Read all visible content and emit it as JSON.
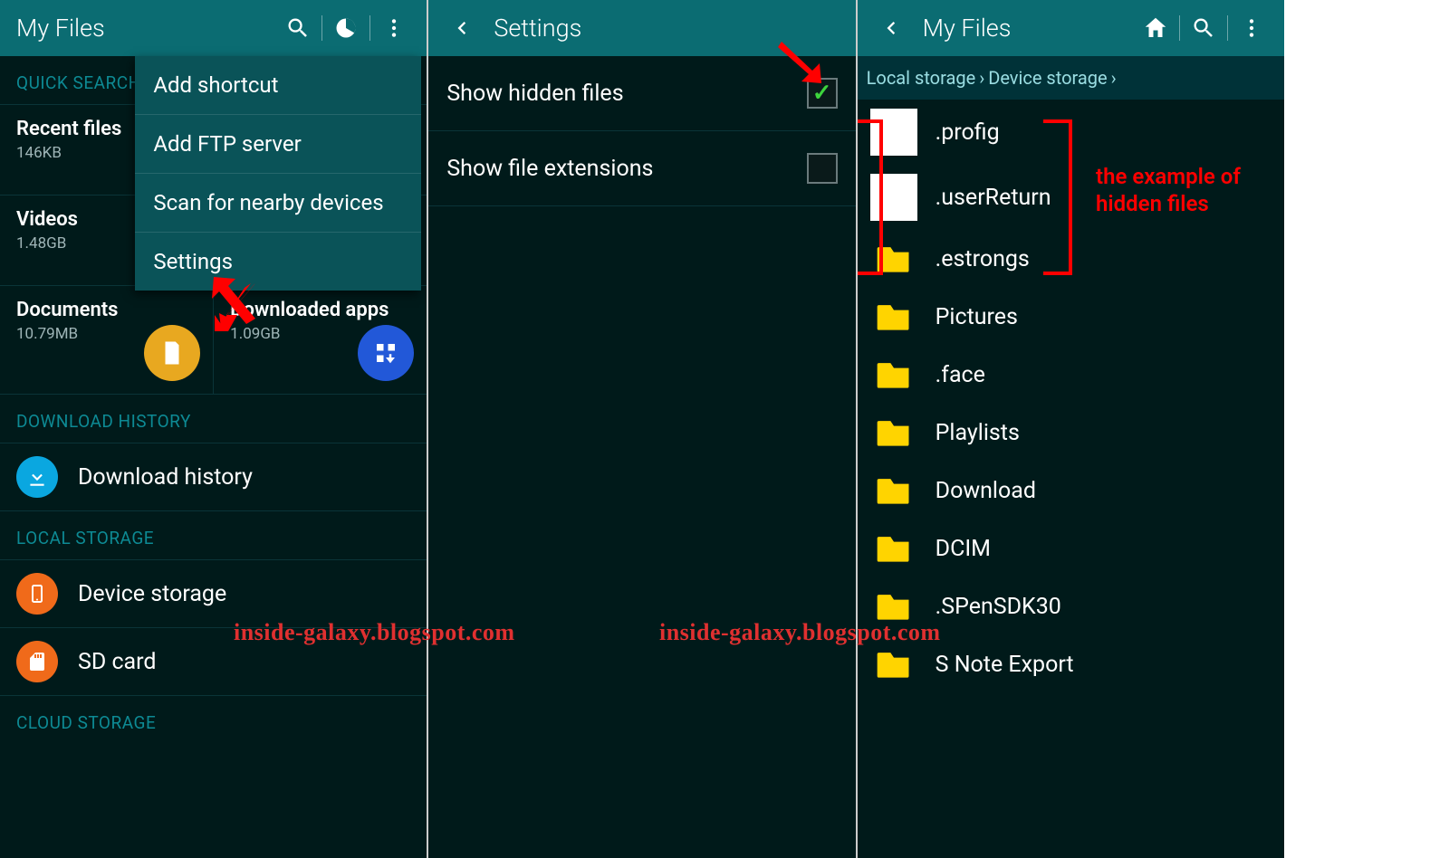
{
  "panel1": {
    "title": "My Files",
    "sections": {
      "quick_search": "QUICK SEARCH",
      "download_history": "DOWNLOAD HISTORY",
      "local_storage": "LOCAL STORAGE",
      "cloud_storage": "CLOUD STORAGE"
    },
    "quick": {
      "recent": {
        "title": "Recent files",
        "sub": "146KB"
      },
      "videos": {
        "title": "Videos",
        "sub": "1.48GB"
      },
      "documents": {
        "title": "Documents",
        "sub": "10.79MB"
      },
      "downloaded": {
        "title": "Downloaded apps",
        "sub": "1.09GB"
      }
    },
    "download_history_item": "Download history",
    "device_storage": "Device storage",
    "sd_card": "SD card",
    "menu": {
      "add_shortcut": "Add shortcut",
      "add_ftp": "Add FTP server",
      "scan_nearby": "Scan for nearby devices",
      "settings": "Settings"
    }
  },
  "panel2": {
    "title": "Settings",
    "show_hidden": "Show hidden files",
    "show_ext": "Show file extensions"
  },
  "panel3": {
    "title": "My Files",
    "breadcrumb": {
      "local": "Local storage",
      "device": "Device storage"
    },
    "files": [
      ".profig",
      ".userReturn",
      ".estrongs",
      "Pictures",
      ".face",
      "Playlists",
      "Download",
      "DCIM",
      ".SPenSDK30",
      "S Note Export"
    ]
  },
  "annotations": {
    "watermark_left": "inside-galaxy.blogspot.com",
    "watermark_right": "inside-galaxy.blogspot.com",
    "hidden_example": "the example of hidden files"
  }
}
